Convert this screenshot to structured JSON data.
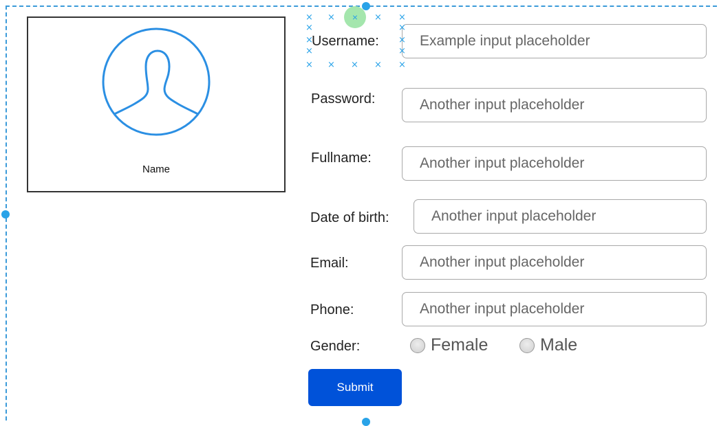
{
  "profile": {
    "name": "Name",
    "avatar_icon": "user-avatar-icon",
    "avatar_color": "#2b8fe3"
  },
  "form": {
    "fields": [
      {
        "label": "Username:",
        "placeholder": "Example input placeholder"
      },
      {
        "label": "Password:",
        "placeholder": "Another input placeholder"
      },
      {
        "label": "Fullname:",
        "placeholder": "Another input placeholder"
      },
      {
        "label": "Date of birth:",
        "placeholder": "Another input placeholder"
      },
      {
        "label": "Email:",
        "placeholder": "Another input placeholder"
      },
      {
        "label": "Phone:",
        "placeholder": "Another input placeholder"
      }
    ],
    "gender": {
      "label": "Gender:",
      "options": [
        "Female",
        "Male"
      ]
    },
    "submit_label": "Submit"
  },
  "colors": {
    "accent": "#0052d9",
    "selection": "#29a3e8"
  }
}
